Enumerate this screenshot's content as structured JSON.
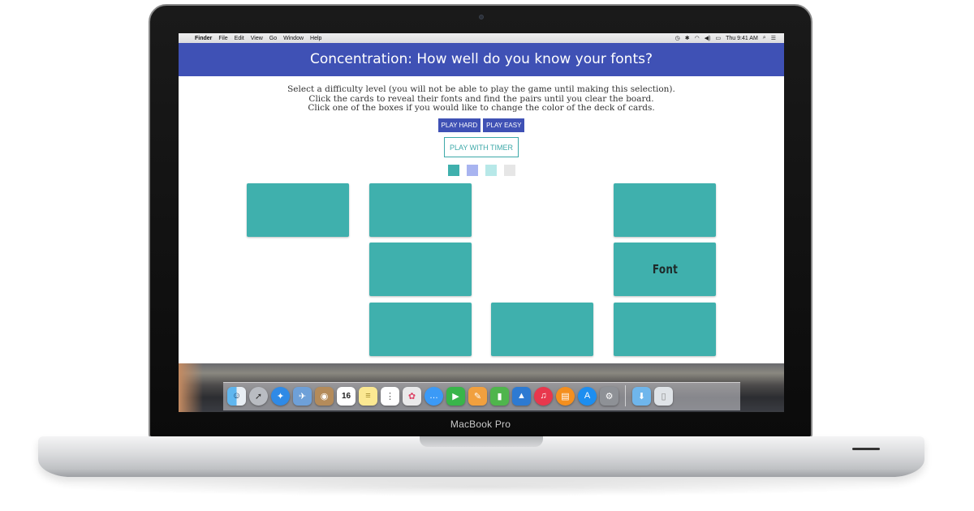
{
  "device": {
    "brand_label": "MacBook Pro"
  },
  "menubar": {
    "apple_glyph": "",
    "app_name": "Finder",
    "items": [
      "File",
      "Edit",
      "View",
      "Go",
      "Window",
      "Help"
    ],
    "clock": "Thu 9:41 AM"
  },
  "page": {
    "title": "Concentration: How well do you know your fonts?",
    "instructions": [
      "Select a difficulty level (you will not be able to play the game until making this selection).",
      "Click the cards to reveal their fonts and find the pairs until you clear the board.",
      "Click one of the boxes if you would like to change the color of the deck of cards."
    ],
    "buttons": {
      "play_hard": "PLAY HARD",
      "play_easy": "PLAY EASY",
      "play_timer": "PLAY WITH TIMER"
    },
    "swatches": [
      "#3fb0ad",
      "#a8b4f0",
      "#b7e8e8",
      "#e6e6e6"
    ],
    "card_color": "#3fb0ad",
    "accent_color": "#3f51b5",
    "revealed_card_text": "Font"
  },
  "dock": {
    "calendar_day": "16",
    "icons": [
      "finder-icon",
      "launchpad-icon",
      "safari-icon",
      "mail-icon",
      "contacts-icon",
      "calendar-icon",
      "notes-icon",
      "reminders-icon",
      "photos-icon",
      "messages-icon",
      "facetime-icon",
      "pages-icon",
      "numbers-icon",
      "keynote-icon",
      "itunes-icon",
      "ibooks-icon",
      "app-store-icon",
      "system-preferences-icon",
      "downloads-folder-icon",
      "trash-icon"
    ]
  }
}
